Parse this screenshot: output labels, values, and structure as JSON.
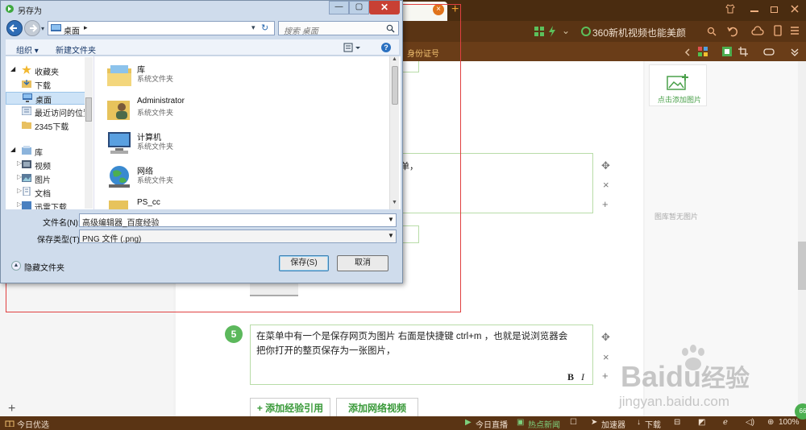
{
  "browser": {
    "tab_close_glyph": "×",
    "tab_plus_glyph": "+",
    "ad_text": "360新机视频也能美颜",
    "toolbar_text": "身份证号",
    "status": {
      "left": "今日优选",
      "live": "今日直播",
      "news": "热点新闻",
      "accelerator": "加速器",
      "download": "下载",
      "zoom": "100%"
    }
  },
  "page": {
    "right_panel": {
      "add_image": "点击添加图片",
      "no_image": "图库暂无图片"
    },
    "step": {
      "number": "5",
      "text_line1": "在菜单中有一个是保存网页为图片 右面是快捷键 ctrl+m ，也就是说浏览器会",
      "text_line2": "把你打开的整页保存为一张图片，",
      "bold": "B",
      "italic": "I"
    },
    "partial_text": "单，",
    "buttons": {
      "add_reference": "添加经验引用",
      "add_reference_prefix": "+",
      "add_video": "添加网络视频"
    },
    "watermark": {
      "logo": "Bai",
      "logo2": "du",
      "jingyan": "经验",
      "url": "jingyan.baidu.com"
    },
    "side_controls": {
      "move": "✥",
      "remove": "×",
      "add": "+"
    },
    "bottom_left_plus": "+"
  },
  "dialog": {
    "title": "另存为",
    "address": "桌面",
    "address_arrow": "▸",
    "search_placeholder": "搜索 桌面",
    "organize": "组织 ▾",
    "new_folder": "新建文件夹",
    "tree": [
      {
        "label": "收藏夹"
      },
      {
        "label": "下载"
      },
      {
        "label": "桌面"
      },
      {
        "label": "最近访问的位置"
      },
      {
        "label": "2345下载"
      },
      {
        "label": "库"
      },
      {
        "label": "视频"
      },
      {
        "label": "图片"
      },
      {
        "label": "文档"
      },
      {
        "label": "迅雷下载"
      }
    ],
    "files": [
      {
        "name": "库",
        "type": "系统文件夹"
      },
      {
        "name": "Administrator",
        "type": "系统文件夹"
      },
      {
        "name": "计算机",
        "type": "系统文件夹"
      },
      {
        "name": "网络",
        "type": "系统文件夹"
      },
      {
        "name": "PS_cc",
        "type": ""
      }
    ],
    "filename_label": "文件名(N):",
    "filename_value": "高级编辑器_百度经验",
    "filetype_label": "保存类型(T):",
    "filetype_value": "PNG 文件 (.png)",
    "hide_folders": "隐藏文件夹",
    "save": "保存(S)",
    "cancel": "取消",
    "help": "?"
  }
}
